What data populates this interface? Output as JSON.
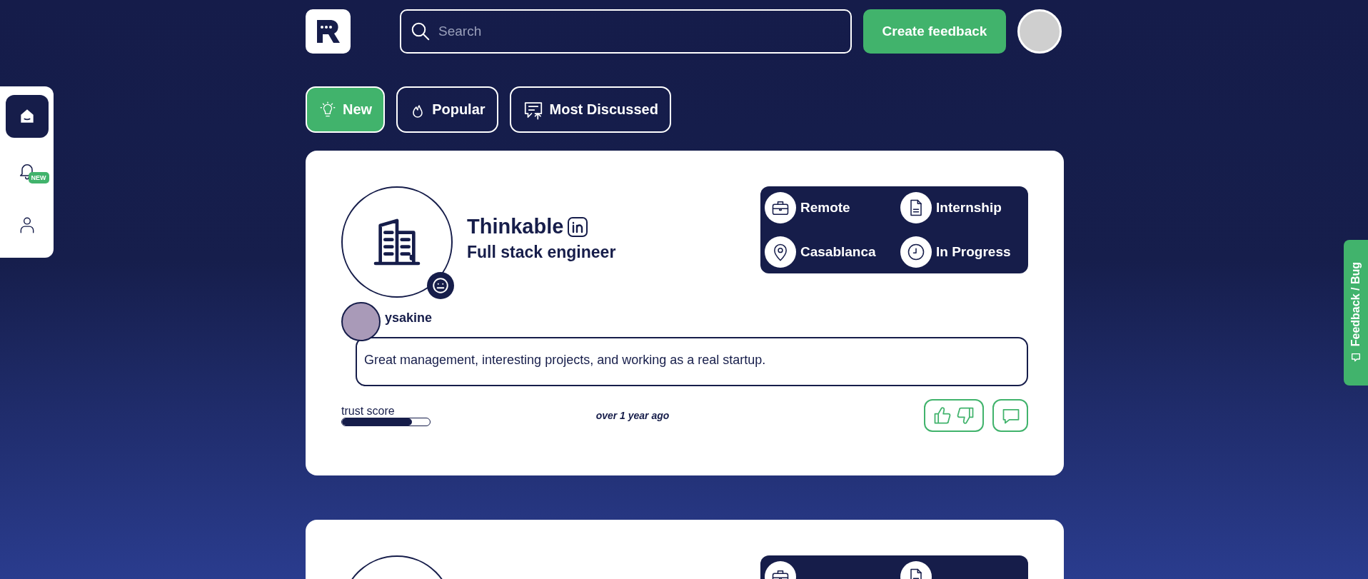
{
  "header": {
    "search": {
      "placeholder": "Search"
    },
    "create_button": "Create feedback"
  },
  "sidebar": {
    "items": [
      {
        "kind": "home",
        "selected": true
      },
      {
        "kind": "bell",
        "selected": false,
        "badge": "NEW"
      },
      {
        "kind": "user",
        "selected": false
      }
    ]
  },
  "filters": [
    {
      "kind": "bulb",
      "label": "New",
      "selected": true
    },
    {
      "kind": "flame",
      "label": "Popular",
      "selected": false
    },
    {
      "kind": "chat",
      "label": "Most Discussed",
      "selected": false
    }
  ],
  "posts": [
    {
      "company": "Thinkable",
      "role": "Full stack engineer",
      "tags": [
        {
          "kind": "briefcase",
          "label": "Remote"
        },
        {
          "kind": "document",
          "label": "Internship"
        },
        {
          "kind": "pin",
          "label": "Casablanca"
        },
        {
          "kind": "clock",
          "label": "In Progress"
        }
      ],
      "reviewer": "ysakine",
      "comment": "Great management, interesting projects, and working as a real startup.",
      "trust_label": "trust score",
      "level": 0.8,
      "time": "over 1 year ago"
    },
    {
      "tags": [
        {
          "kind": "briefcase"
        },
        {
          "kind": "document"
        }
      ]
    }
  ],
  "feedback_tab": "Feedback / Bug"
}
